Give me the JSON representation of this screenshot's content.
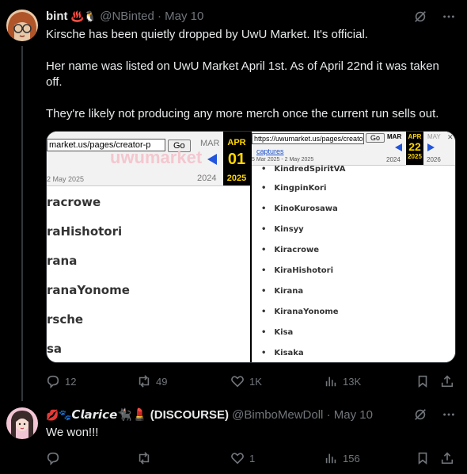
{
  "post1": {
    "name": "bint",
    "name_emoji": "♨️🐧",
    "handle": "@NBinted",
    "sep": "·",
    "date": "May 10",
    "paragraphs": [
      "Kirsche has been quietly dropped by UwU Market. It's official.",
      "Her name was listed on UwU Market April 1st. As of April 22nd it was taken off.",
      "They're likely not producing any more merch once the current run sells out."
    ],
    "media": {
      "left": {
        "url": "market.us/pages/creator-p",
        "go": "Go",
        "month_prev": "MAR",
        "month_cur": "APR",
        "day": "01",
        "year_prev": "2024",
        "year_cur": "2025",
        "range": "2 May 2025",
        "logo": "uwumarket",
        "names": [
          "racrowe",
          "raHishotori",
          "rana",
          "ranaYonome",
          "rsche",
          "sa"
        ]
      },
      "right": {
        "url": "https://uwumarket.us/pages/creator-p",
        "go": "Go",
        "month_prev": "MAR",
        "month_cur": "APR",
        "month_next": "MAY",
        "day": "22",
        "year_prev": "2024",
        "year_cur": "2025",
        "year_next": "2026",
        "captures": "captures",
        "range": "5 Mar 2025 - 2 May 2025",
        "names": [
          "KindredSpiritVA",
          "KingpinKori",
          "KinoKurosawa",
          "Kinsyy",
          "Kiracrowe",
          "KiraHishotori",
          "Kirana",
          "KiranaYonome",
          "Kisa",
          "Kisaka"
        ]
      }
    },
    "actions": {
      "replies": "12",
      "reposts": "49",
      "likes": "1K",
      "views": "13K"
    }
  },
  "post2": {
    "name_prefix": "💋🐾",
    "name": "𝘾𝙡𝙖𝙧𝙞𝙘𝙚",
    "name_suffix": "🐈‍⬛💄 (DISCOURSE)",
    "handle": "@BimboMewDoll",
    "sep": "·",
    "date": "May 10",
    "text": "We won!!!",
    "actions": {
      "replies": "",
      "reposts": "",
      "likes": "1",
      "views": "156"
    }
  },
  "icons": [
    "grok-icon",
    "more-icon",
    "reply-icon",
    "repost-icon",
    "like-icon",
    "views-icon",
    "bookmark-icon",
    "share-icon"
  ],
  "colors": {
    "background": "#000000",
    "muted": "#71767b",
    "text": "#e7e9ea",
    "wayback_year": "#ffd700",
    "wayback_arrow": "#2255dd"
  }
}
